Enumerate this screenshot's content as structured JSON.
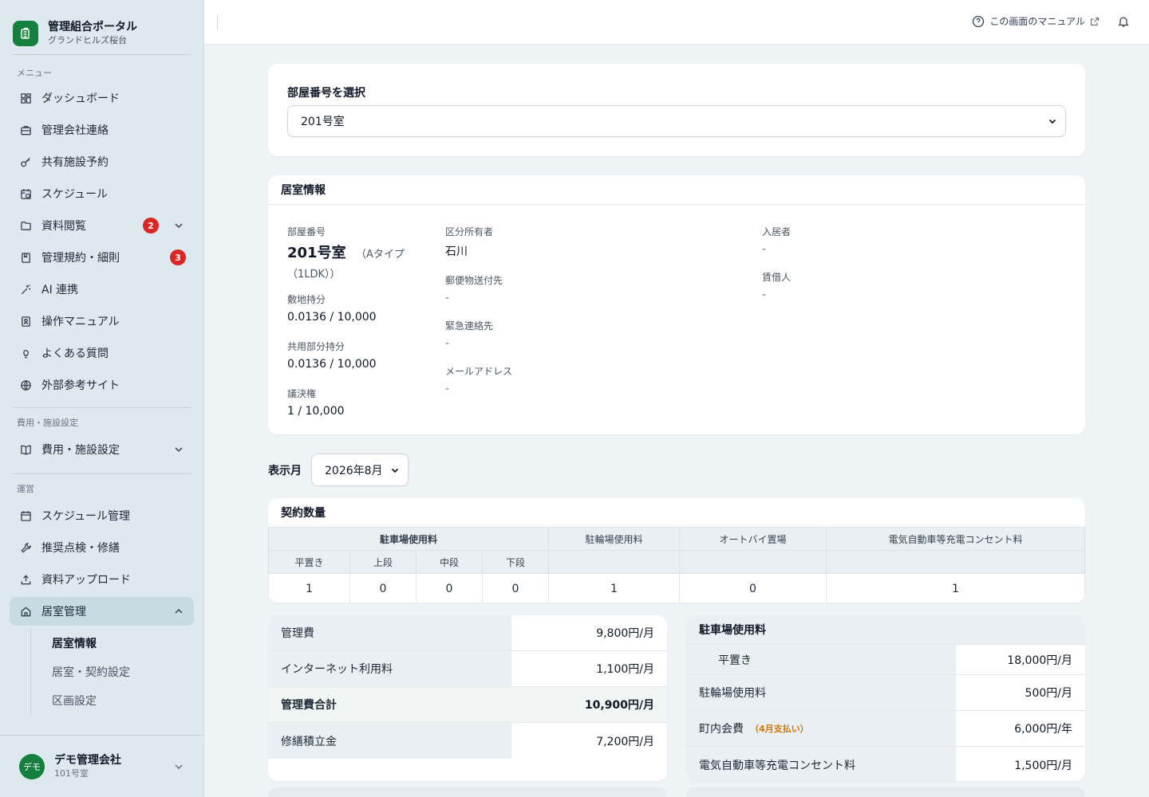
{
  "brand": {
    "title": "管理組合ポータル",
    "subtitle": "グランドヒルズ桜台"
  },
  "sidebar": {
    "menu_label": "メニュー",
    "menu_items": [
      {
        "label": "ダッシュボード",
        "icon": "dashboard-icon"
      },
      {
        "label": "管理会社連絡",
        "icon": "briefcase-icon"
      },
      {
        "label": "共有施設予約",
        "icon": "key-icon"
      },
      {
        "label": "スケジュール",
        "icon": "calendar-clock-icon"
      },
      {
        "label": "資料閲覧",
        "icon": "folder-icon",
        "badge": "2"
      },
      {
        "label": "管理規約・細則",
        "icon": "book-icon",
        "badge": "3"
      },
      {
        "label": "AI 連携",
        "icon": "sparkle-icon"
      },
      {
        "label": "操作マニュアル",
        "icon": "manual-icon"
      },
      {
        "label": "よくある質問",
        "icon": "lightbulb-icon"
      },
      {
        "label": "外部参考サイト",
        "icon": "globe-icon"
      }
    ],
    "settings_label": "費用・施設設定",
    "settings_item": "費用・施設設定",
    "ops_label": "運営",
    "ops_items": [
      {
        "label": "スケジュール管理",
        "icon": "calendar-icon"
      },
      {
        "label": "推奨点検・修繕",
        "icon": "wrench-icon"
      },
      {
        "label": "資料アップロード",
        "icon": "upload-icon"
      },
      {
        "label": "居室管理",
        "icon": "home-icon"
      }
    ],
    "sub_items": [
      "居室情報",
      "居室・契約設定",
      "区画設定"
    ]
  },
  "user": {
    "avatar": "デモ",
    "name": "デモ管理会社",
    "room": "101号室"
  },
  "topbar": {
    "manual": "この画面のマニュアル"
  },
  "room_select": {
    "label": "部屋番号を選択",
    "value": "201号室"
  },
  "room_info": {
    "title": "居室情報",
    "room_no_label": "部屋番号",
    "room_no": "201号室",
    "room_type": "（Aタイプ",
    "room_layout": "（1LDK））",
    "land_label": "敷地持分",
    "land_value": "0.0136 / 10,000",
    "common_label": "共用部分持分",
    "common_value": "0.0136 / 10,000",
    "vote_label": "議決権",
    "vote_value": "1 / 10,000",
    "owner_label": "区分所有者",
    "owner_value": "石川",
    "mail_label": "郵便物送付先",
    "mail_value": "-",
    "emergency_label": "緊急連絡先",
    "emergency_value": "-",
    "email_label": "メールアドレス",
    "email_value": "-",
    "resident_label": "入居者",
    "resident_value": "-",
    "tenant_label": "賃借人",
    "tenant_value": "-"
  },
  "month": {
    "label": "表示月",
    "value": "2026年8月"
  },
  "contract": {
    "title": "契約数量",
    "headers": [
      "駐車場使用料",
      "駐輪場使用料",
      "オートバイ置場",
      "電気自動車等充電コンセント料"
    ],
    "sub_headers": [
      "平置き",
      "上段",
      "中段",
      "下段"
    ],
    "values": [
      "1",
      "0",
      "0",
      "0",
      "1",
      "0",
      "1"
    ]
  },
  "fees_left": [
    {
      "label": "管理費",
      "value": "9,800円/月"
    },
    {
      "label": "インターネット利用料",
      "value": "1,100円/月"
    },
    {
      "label": "管理費合計",
      "value": "10,900円/月"
    },
    {
      "label": "修繕積立金",
      "value": "7,200円/月"
    }
  ],
  "fees_right": {
    "title": "駐車場使用料",
    "rows": [
      {
        "label": "平置き",
        "value": "18,000円/月"
      },
      {
        "label": "駐輪場使用料",
        "value": "500円/月"
      },
      {
        "label": "町内会費",
        "note": "（4月支払い）",
        "value": "6,000円/年"
      },
      {
        "label": "電気自動車等充電コンセント料",
        "value": "1,500円/月"
      }
    ]
  },
  "colors": {
    "brand": "#15803d",
    "badge": "#dc2626",
    "note": "#d97706"
  }
}
